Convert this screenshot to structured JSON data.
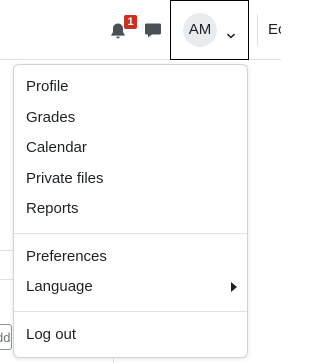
{
  "navbar": {
    "notification_count": "1",
    "avatar_initials": "AM",
    "edit_mode_label_partial": "Ec"
  },
  "user_menu": {
    "items": [
      {
        "label": "Profile"
      },
      {
        "label": "Grades"
      },
      {
        "label": "Calendar"
      },
      {
        "label": "Private files"
      },
      {
        "label": "Reports"
      }
    ],
    "preferences_label": "Preferences",
    "language_label": "Language",
    "logout_label": "Log out"
  },
  "background": {
    "input_fragment": "dd"
  },
  "colors": {
    "badge": "#ca3120",
    "text": "#1d2125",
    "avatar_bg": "#e9ecef",
    "divider": "#dee2e6"
  }
}
